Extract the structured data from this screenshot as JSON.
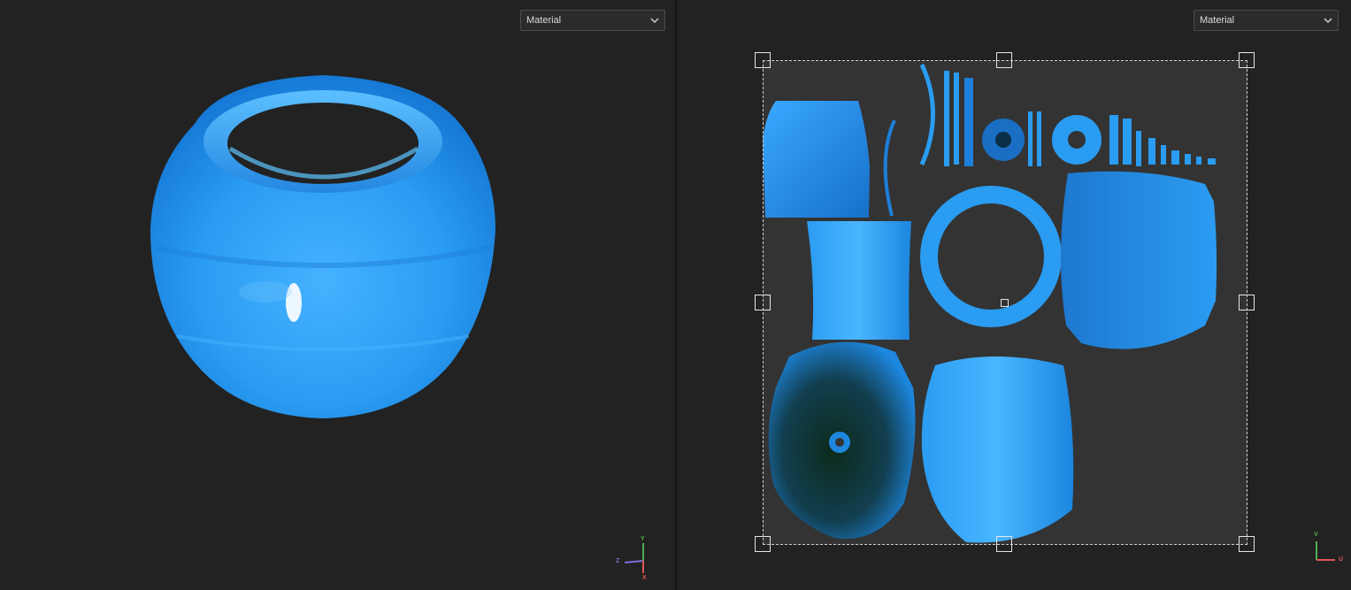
{
  "viewport_3d": {
    "material_dropdown": {
      "selected": "Material"
    },
    "axes": {
      "y": "Y",
      "z": "Z",
      "x": "X"
    },
    "axis_colors": {
      "y": "#4caf50",
      "z": "#7b6fd6",
      "x": "#e05555"
    }
  },
  "viewport_uv": {
    "material_dropdown": {
      "selected": "Material"
    },
    "axes": {
      "v": "V",
      "u": "U"
    },
    "axis_colors": {
      "v": "#4caf50",
      "u": "#e05555"
    }
  },
  "colors": {
    "mesh_blue": "#2a9cf2",
    "uv_tile_bg": "#333333",
    "panel_bg": "#222222"
  },
  "icons": [
    "chevron-down-icon",
    "axis-gizmo-icon",
    "uv-axis-gizmo-icon"
  ]
}
